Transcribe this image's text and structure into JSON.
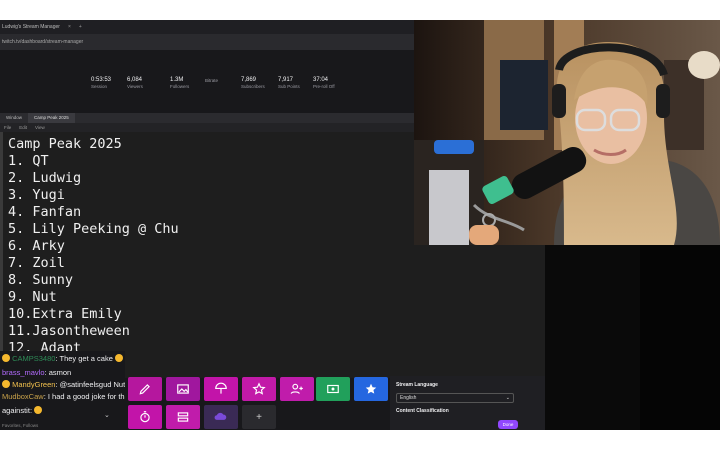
{
  "window": {
    "tab_title": "Ludwig's Stream Manager",
    "url": "twitch.tv/dashboard/stream-manager"
  },
  "stats": [
    {
      "value": "0:53:53",
      "label": "Session"
    },
    {
      "value": "6,084",
      "label": "Viewers"
    },
    {
      "value": "1.3M",
      "label": "Followers"
    },
    {
      "value": "",
      "label": "Bitrate"
    },
    {
      "value": "7,869",
      "label": "Subscribers"
    },
    {
      "value": "7,917",
      "label": "Sub Points"
    },
    {
      "value": "37:04",
      "label": "Pre-roll Off"
    }
  ],
  "editor": {
    "tabs": [
      "Window",
      "Camp Peak 2025"
    ],
    "menu": [
      "File",
      "Edit",
      "View"
    ],
    "lines": [
      "Camp Peak 2025",
      "1. QT",
      "2. Ludwig",
      "3. Yugi",
      "4. Fanfan",
      "5. Lily Peeking @ Chu",
      "6. Arky",
      "7. Zoil",
      "8. Sunny",
      "9. Nut",
      "10.Extra Emily",
      "11.Jasontheween",
      "12. Adapt"
    ]
  },
  "chat": {
    "messages": [
      {
        "user": "CAMPS3480",
        "text": "They get a cake"
      },
      {
        "user": "brass_mavlo",
        "text": "asmon"
      },
      {
        "user": "MandyGreen",
        "text": "@satinfeelsgud Nut"
      },
      {
        "user": "MudboxCaw",
        "text": "I had a good joke for that but decided"
      },
      {
        "user": "againstit",
        "text": ""
      }
    ],
    "footer": "Favorites, Follows"
  },
  "settings_panel": {
    "language_label": "Stream Language",
    "language_value": "English",
    "classification_label": "Content Classification",
    "done_label": "Done"
  },
  "colors": {
    "accent": "#9147ff",
    "magenta": "#d12ac8",
    "green": "#21a05b",
    "blue": "#2567e0"
  }
}
